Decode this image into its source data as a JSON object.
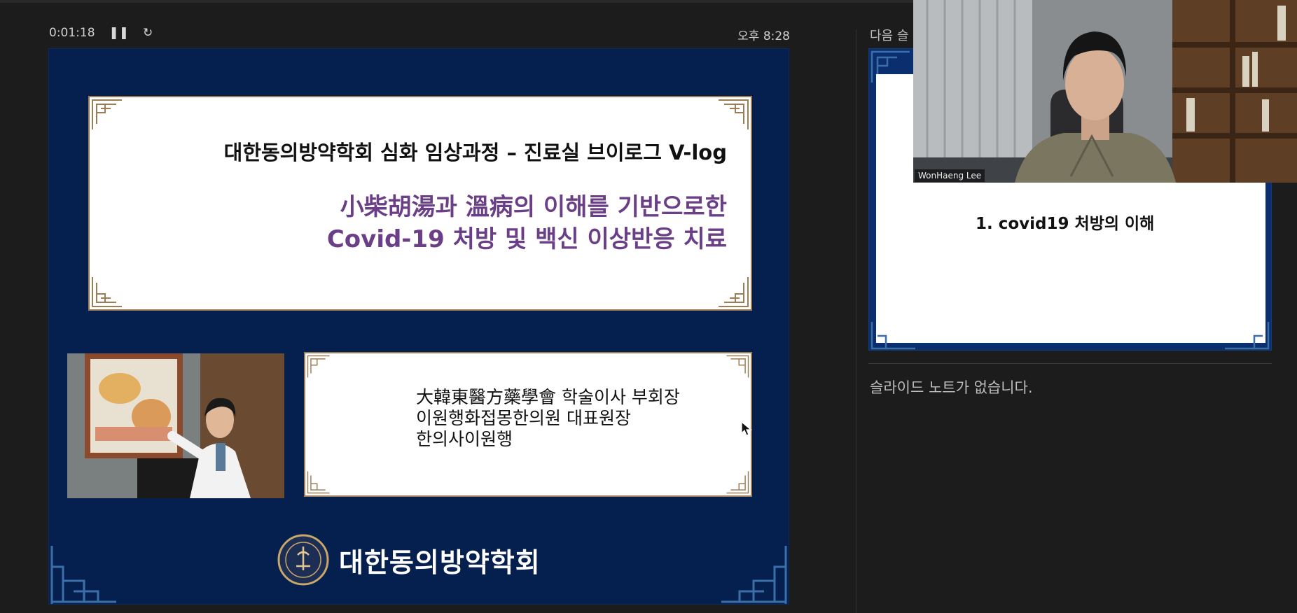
{
  "presenter": {
    "elapsed_time": "0:01:18",
    "pause_icon": "pause-icon",
    "restart_icon": "restart-icon",
    "clock": "오후 8:28"
  },
  "current_slide": {
    "heading": "대한동의방약학회 심화 임상과정 – 진료실 브이로그 V-log",
    "title_line1": "小柴胡湯과 溫病의 이해를 기반으로한",
    "title_line2": "Covid-19 처방 및 백신 이상반응 치료",
    "info_line1": "大韓東醫方藥學會 학술이사 부회장",
    "info_line2": "이원행화접몽한의원 대표원장",
    "info_line3": "한의사이원행",
    "logo_text": "대한동의방약학회",
    "colors": {
      "background": "#05204f",
      "title_accent": "#6b3f87",
      "frame": "#9c7d55"
    }
  },
  "next_slide": {
    "label": "다음 슬",
    "title": "1. covid19 처방의 이해"
  },
  "notes": {
    "text": "슬라이드 노트가 없습니다."
  },
  "webcam": {
    "name": "WonHaeng Lee"
  }
}
